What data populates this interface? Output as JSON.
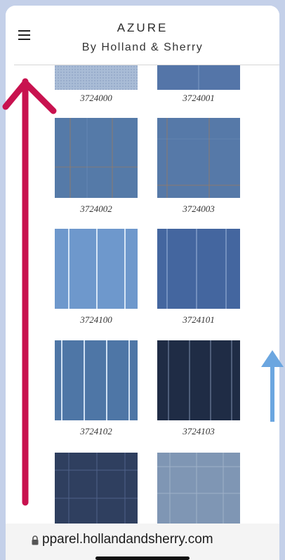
{
  "header": {
    "brand_title": "AZURE",
    "brand_subtitle": "By Holland & Sherry",
    "menu_icon": "hamburger-menu-icon"
  },
  "fabrics": [
    {
      "code": "3724000",
      "color": "#a9bcd6",
      "pattern": "micro-check"
    },
    {
      "code": "3724001",
      "color": "#5475a8",
      "pattern": "stripe"
    },
    {
      "code": "3724002",
      "color": "#557aa8",
      "pattern": "windowpane-rust"
    },
    {
      "code": "3724003",
      "color": "#5679a8",
      "pattern": "windowpane-rust"
    },
    {
      "code": "3724100",
      "color": "#6e98cc",
      "pattern": "chalk-stripe"
    },
    {
      "code": "3724101",
      "color": "#44669f",
      "pattern": "pinstripe"
    },
    {
      "code": "3724102",
      "color": "#4e76a6",
      "pattern": "chalk-stripe"
    },
    {
      "code": "3724103",
      "color": "#1f2c45",
      "pattern": "pinstripe"
    },
    {
      "code": "",
      "color": "#2f3f5f",
      "pattern": "grid-check"
    },
    {
      "code": "",
      "color": "#7f96b4",
      "pattern": "grid-check"
    }
  ],
  "browser": {
    "lock_icon": "lock-icon",
    "url": "pparel.hollandandsherry.com"
  },
  "overlay": {
    "left_arrow_color": "#c8124f",
    "right_arrow_color": "#6ba6e0"
  },
  "colors": {
    "background": "#c4d0e9",
    "page": "#ffffff"
  }
}
